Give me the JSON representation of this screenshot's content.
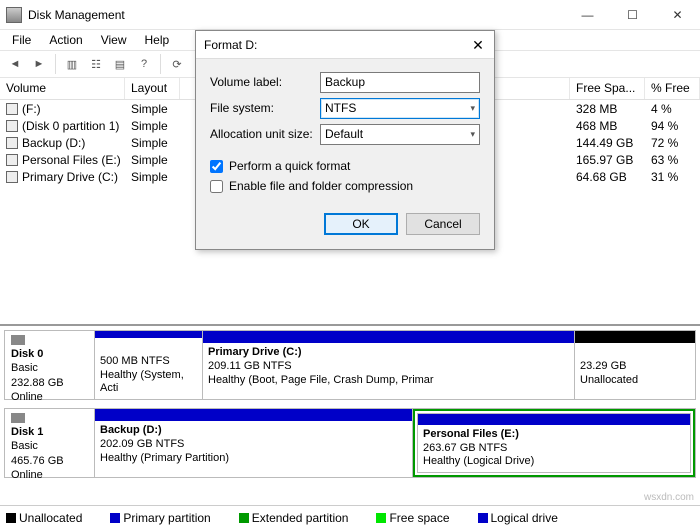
{
  "window": {
    "title": "Disk Management"
  },
  "menu": {
    "items": [
      "File",
      "Action",
      "View",
      "Help"
    ]
  },
  "columns": {
    "volume": "Volume",
    "layout": "Layout",
    "free": "Free Spa...",
    "pct": "% Free"
  },
  "volumes": [
    {
      "name": "(F:)",
      "layout": "Simple",
      "free": "328 MB",
      "pct": "4 %"
    },
    {
      "name": "(Disk 0 partition 1)",
      "layout": "Simple",
      "free": "468 MB",
      "pct": "94 %"
    },
    {
      "name": "Backup (D:)",
      "layout": "Simple",
      "free": "144.49 GB",
      "pct": "72 %"
    },
    {
      "name": "Personal Files (E:)",
      "layout": "Simple",
      "free": "165.97 GB",
      "pct": "63 %"
    },
    {
      "name": "Primary Drive (C:)",
      "layout": "Simple",
      "free": "64.68 GB",
      "pct": "31 %"
    }
  ],
  "disks": [
    {
      "label": "Disk 0",
      "type": "Basic",
      "size": "232.88 GB",
      "status": "Online"
    },
    {
      "label": "Disk 1",
      "type": "Basic",
      "size": "465.76 GB",
      "status": "Online"
    }
  ],
  "d0": {
    "p0": {
      "l1": "",
      "l2": "500 MB NTFS",
      "l3": "Healthy (System, Acti"
    },
    "p1": {
      "name": "Primary Drive  (C:)",
      "l2": "209.11 GB NTFS",
      "l3": "Healthy (Boot, Page File, Crash Dump, Primar"
    },
    "p2": {
      "l2": "23.29 GB",
      "l3": "Unallocated"
    }
  },
  "d1": {
    "p0": {
      "name": "Backup  (D:)",
      "l2": "202.09 GB NTFS",
      "l3": "Healthy (Primary Partition)"
    },
    "p1": {
      "name": "Personal Files  (E:)",
      "l2": "263.67 GB NTFS",
      "l3": "Healthy (Logical Drive)"
    }
  },
  "legend": {
    "unalloc": "Unallocated",
    "primary": "Primary partition",
    "extended": "Extended partition",
    "free": "Free space",
    "logical": "Logical drive"
  },
  "dialog": {
    "title": "Format D:",
    "vol_label": "Volume label:",
    "vol_value": "Backup",
    "fs_label": "File system:",
    "fs_value": "NTFS",
    "au_label": "Allocation unit size:",
    "au_value": "Default",
    "quick": "Perform a quick format",
    "compress": "Enable file and folder compression",
    "ok": "OK",
    "cancel": "Cancel"
  },
  "watermark": "wsxdn.com"
}
